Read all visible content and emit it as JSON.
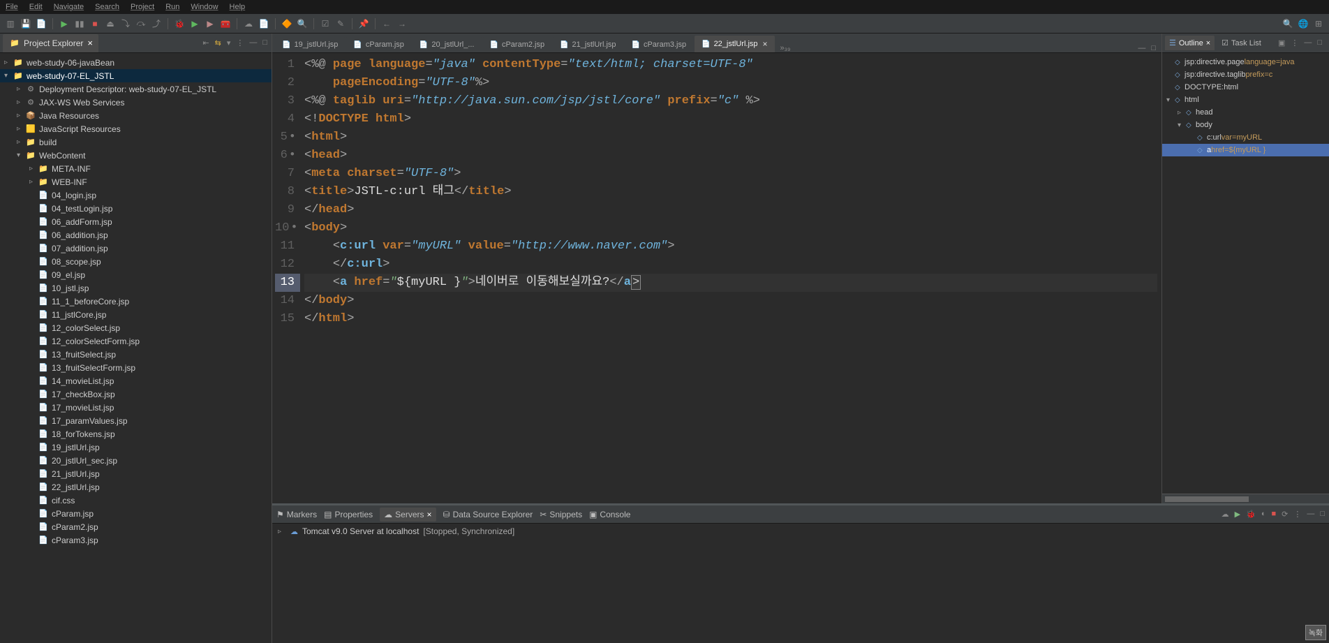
{
  "menubar": [
    "File",
    "Edit",
    "Navigate",
    "Search",
    "Project",
    "Run",
    "Window",
    "Help"
  ],
  "left_panel": {
    "title": "Project Explorer",
    "tree": [
      {
        "d": 0,
        "twist": "▹",
        "icon": "proj",
        "label": "web-study-06-javaBean"
      },
      {
        "d": 0,
        "twist": "▾",
        "icon": "proj",
        "label": "web-study-07-EL_JSTL",
        "sel": true
      },
      {
        "d": 1,
        "twist": "▹",
        "icon": "gear",
        "label": "Deployment Descriptor: web-study-07-EL_JSTL"
      },
      {
        "d": 1,
        "twist": "▹",
        "icon": "gear",
        "label": "JAX-WS Web Services"
      },
      {
        "d": 1,
        "twist": "▹",
        "icon": "pkg",
        "label": "Java Resources"
      },
      {
        "d": 1,
        "twist": "▹",
        "icon": "js",
        "label": "JavaScript Resources"
      },
      {
        "d": 1,
        "twist": "▹",
        "icon": "folder",
        "label": "build"
      },
      {
        "d": 1,
        "twist": "▾",
        "icon": "folder",
        "label": "WebContent"
      },
      {
        "d": 2,
        "twist": "▹",
        "icon": "folder",
        "label": "META-INF"
      },
      {
        "d": 2,
        "twist": "▹",
        "icon": "folder",
        "label": "WEB-INF"
      },
      {
        "d": 2,
        "twist": "",
        "icon": "file",
        "label": "04_login.jsp"
      },
      {
        "d": 2,
        "twist": "",
        "icon": "file",
        "label": "04_testLogin.jsp"
      },
      {
        "d": 2,
        "twist": "",
        "icon": "file",
        "label": "06_addForm.jsp"
      },
      {
        "d": 2,
        "twist": "",
        "icon": "file",
        "label": "06_addition.jsp"
      },
      {
        "d": 2,
        "twist": "",
        "icon": "file",
        "label": "07_addition.jsp"
      },
      {
        "d": 2,
        "twist": "",
        "icon": "file",
        "label": "08_scope.jsp"
      },
      {
        "d": 2,
        "twist": "",
        "icon": "file",
        "label": "09_el.jsp"
      },
      {
        "d": 2,
        "twist": "",
        "icon": "file",
        "label": "10_jstl.jsp"
      },
      {
        "d": 2,
        "twist": "",
        "icon": "file",
        "label": "11_1_beforeCore.jsp"
      },
      {
        "d": 2,
        "twist": "",
        "icon": "file",
        "label": "11_jstlCore.jsp"
      },
      {
        "d": 2,
        "twist": "",
        "icon": "file",
        "label": "12_colorSelect.jsp"
      },
      {
        "d": 2,
        "twist": "",
        "icon": "file",
        "label": "12_colorSelectForm.jsp"
      },
      {
        "d": 2,
        "twist": "",
        "icon": "file",
        "label": "13_fruitSelect.jsp"
      },
      {
        "d": 2,
        "twist": "",
        "icon": "file",
        "label": "13_fruitSelectForm.jsp"
      },
      {
        "d": 2,
        "twist": "",
        "icon": "file",
        "label": "14_movieList.jsp"
      },
      {
        "d": 2,
        "twist": "",
        "icon": "file",
        "label": "17_checkBox.jsp"
      },
      {
        "d": 2,
        "twist": "",
        "icon": "file",
        "label": "17_movieList.jsp"
      },
      {
        "d": 2,
        "twist": "",
        "icon": "file",
        "label": "17_paramValues.jsp"
      },
      {
        "d": 2,
        "twist": "",
        "icon": "file",
        "label": "18_forTokens.jsp"
      },
      {
        "d": 2,
        "twist": "",
        "icon": "file",
        "label": "19_jstlUrl.jsp"
      },
      {
        "d": 2,
        "twist": "",
        "icon": "file",
        "label": "20_jstlUrl_sec.jsp"
      },
      {
        "d": 2,
        "twist": "",
        "icon": "file",
        "label": "21_jstlUrl.jsp"
      },
      {
        "d": 2,
        "twist": "",
        "icon": "file",
        "label": "22_jstlUrl.jsp"
      },
      {
        "d": 2,
        "twist": "",
        "icon": "file",
        "label": "cif.css"
      },
      {
        "d": 2,
        "twist": "",
        "icon": "file",
        "label": "cParam.jsp"
      },
      {
        "d": 2,
        "twist": "",
        "icon": "file",
        "label": "cParam2.jsp"
      },
      {
        "d": 2,
        "twist": "",
        "icon": "file",
        "label": "cParam3.jsp"
      }
    ]
  },
  "editor": {
    "tabs": [
      {
        "label": "19_jstlUrl.jsp"
      },
      {
        "label": "cParam.jsp"
      },
      {
        "label": "20_jstlUrl_..."
      },
      {
        "label": "cParam2.jsp"
      },
      {
        "label": "21_jstlUrl.jsp"
      },
      {
        "label": "cParam3.jsp"
      },
      {
        "label": "22_jstlUrl.jsp",
        "active": true
      }
    ],
    "overflow_label": "»₃₉",
    "line_numbers": [
      "1",
      "2",
      "3",
      "4",
      "5",
      "6",
      "7",
      "8",
      "9",
      "10",
      "11",
      "12",
      "13",
      "14",
      "15"
    ],
    "dirty_lines": [
      5,
      6,
      10
    ],
    "current_line": 13,
    "code": {
      "l1": {
        "a": "<%@ ",
        "b": "page ",
        "c": "language",
        "eq": "=",
        "d": "\"java\"",
        "sp": " ",
        "e": "contentType",
        "f": "=",
        "g": "\"text/html; charset=UTF-8\""
      },
      "l2": {
        "a": "    ",
        "b": "pageEncoding",
        "c": "=",
        "d": "\"UTF-8\"",
        "e": "%>"
      },
      "l3": {
        "a": "<%@ ",
        "b": "taglib ",
        "c": "uri",
        "d": "=",
        "e": "\"http://java.sun.com/jsp/jstl/core\"",
        "sp": " ",
        "f": "prefix",
        "g": "=",
        "h": "\"c\"",
        "i": " %>"
      },
      "l4": {
        "a": "<!",
        "b": "DOCTYPE ",
        "c": "html",
        "d": ">"
      },
      "l5": {
        "a": "<",
        "b": "html",
        "c": ">"
      },
      "l6": {
        "a": "<",
        "b": "head",
        "c": ">"
      },
      "l7": {
        "a": "<",
        "b": "meta ",
        "c": "charset",
        "d": "=",
        "e": "\"UTF-8\"",
        "f": ">"
      },
      "l8": {
        "a": "<",
        "b": "title",
        "c": ">",
        "d": "JSTL-c:url 태그",
        "e": "</",
        "f": "title",
        "g": ">"
      },
      "l9": {
        "a": "</",
        "b": "head",
        "c": ">"
      },
      "l10": {
        "a": "<",
        "b": "body",
        "c": ">"
      },
      "l11": {
        "a": "    <",
        "b": "c:url ",
        "c": "var",
        "d": "=",
        "e": "\"myURL\"",
        "sp": " ",
        "f": "value",
        "g": "=",
        "h": "\"http://www.naver.com\"",
        "i": ">"
      },
      "l12": {
        "a": "    </",
        "b": "c:url",
        "c": ">"
      },
      "l13": {
        "a": "    <",
        "b": "a ",
        "c": "href",
        "d": "=",
        "e": "\"",
        "f": "${myURL }",
        "g": "\"",
        "h": ">",
        "i": "네이버로 이동해보실까요?",
        "j": "</",
        "k": "a",
        "l": ">"
      },
      "l14": {
        "a": "</",
        "b": "body",
        "c": ">"
      },
      "l15": {
        "a": "</",
        "b": "html",
        "c": ">"
      }
    }
  },
  "outline": {
    "title": "Outline",
    "tasklist": "Task List",
    "items": [
      {
        "d": 0,
        "twist": "",
        "icon": "dir",
        "label": "jsp:directive.page",
        "attr": " language=java"
      },
      {
        "d": 0,
        "twist": "",
        "icon": "dir",
        "label": "jsp:directive.taglib",
        "attr": " prefix=c"
      },
      {
        "d": 0,
        "twist": "",
        "icon": "doc",
        "label": "DOCTYPE:html",
        "attr": ""
      },
      {
        "d": 0,
        "twist": "▾",
        "icon": "tag",
        "label": "html",
        "attr": ""
      },
      {
        "d": 1,
        "twist": "▹",
        "icon": "tag",
        "label": "head",
        "attr": ""
      },
      {
        "d": 1,
        "twist": "▾",
        "icon": "tag",
        "label": "body",
        "attr": ""
      },
      {
        "d": 2,
        "twist": "",
        "icon": "tag",
        "label": "c:url",
        "attr": " var=myURL"
      },
      {
        "d": 2,
        "twist": "",
        "icon": "tag",
        "label": "a",
        "attr": " href=${myURL }",
        "sel": true
      }
    ]
  },
  "bottom": {
    "tabs": [
      {
        "icon": "⚑",
        "label": "Markers"
      },
      {
        "icon": "▤",
        "label": "Properties"
      },
      {
        "icon": "☁",
        "label": "Servers",
        "active": true
      },
      {
        "icon": "⛁",
        "label": "Data Source Explorer"
      },
      {
        "icon": "✂",
        "label": "Snippets"
      },
      {
        "icon": "▣",
        "label": "Console"
      }
    ],
    "server": {
      "name": "Tomcat v9.0 Server at localhost",
      "status": "  [Stopped, Synchronized]"
    }
  },
  "watermark": "녹화"
}
